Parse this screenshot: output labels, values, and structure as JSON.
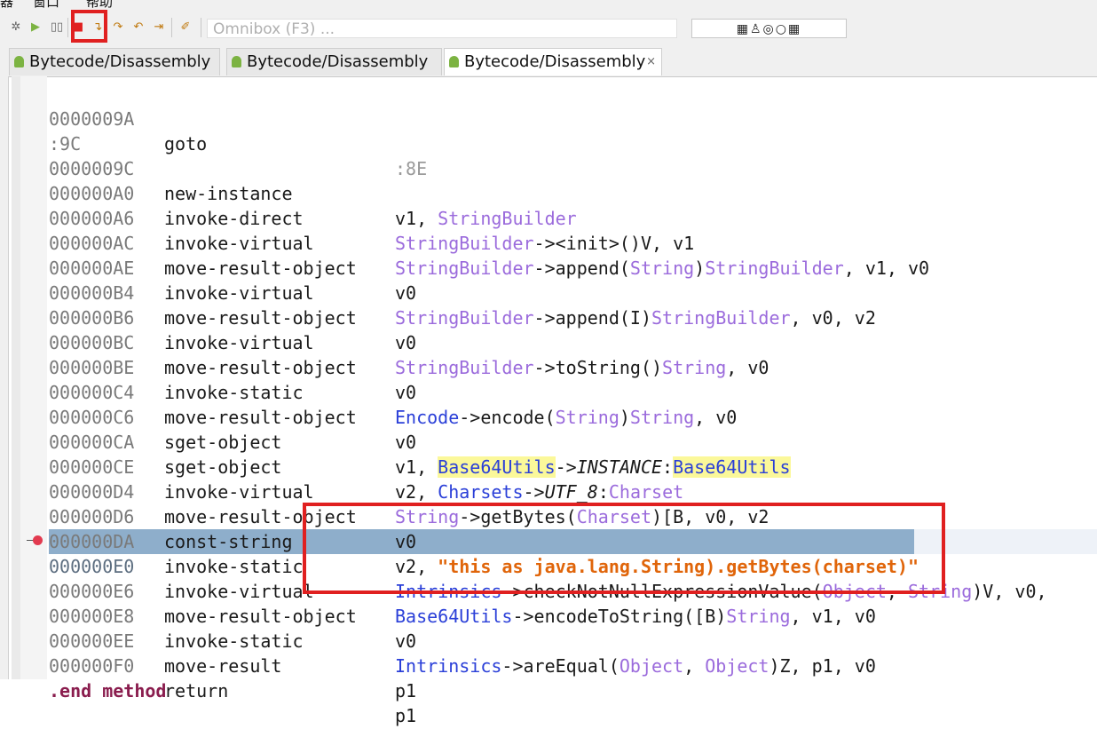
{
  "menu": {
    "item1": "器",
    "item2": "窗口",
    "item3": "帮助"
  },
  "toolbar": {
    "omnibox_placeholder": "Omnibox (F3) ...",
    "mode_icons": "▦♙◎○▦"
  },
  "tabs": [
    {
      "label": "Bytecode/Disassembly",
      "close": ""
    },
    {
      "label": "Bytecode/Disassembly",
      "close": ""
    },
    {
      "label": "Bytecode/Disassembly",
      "close": "×"
    }
  ],
  "code": {
    "l1": {
      "addr": "0000009A",
      "op": "goto",
      "a": ":8E"
    },
    "label": ":9C",
    "l2": {
      "addr": "0000009C",
      "op": "new-instance",
      "p1": "v1, ",
      "t1": "StringBuilder"
    },
    "l3": {
      "addr": "000000A0",
      "op": "invoke-direct",
      "t1": "StringBuilder",
      "p1": "-><init>()V, v1"
    },
    "l4": {
      "addr": "000000A6",
      "op": "invoke-virtual",
      "t1": "StringBuilder",
      "p1": "->append(",
      "t2": "String",
      "p2": ")",
      "t3": "StringBuilder",
      "p3": ", v1, v0"
    },
    "l5": {
      "addr": "000000AC",
      "op": "move-result-object",
      "a": "v0"
    },
    "l6": {
      "addr": "000000AE",
      "op": "invoke-virtual",
      "t1": "StringBuilder",
      "p1": "->append(I)",
      "t2": "StringBuilder",
      "p2": ", v0, v2"
    },
    "l7": {
      "addr": "000000B4",
      "op": "move-result-object",
      "a": "v0"
    },
    "l8": {
      "addr": "000000B6",
      "op": "invoke-virtual",
      "t1": "StringBuilder",
      "p1": "->toString()",
      "t2": "String",
      "p2": ", v0"
    },
    "l9": {
      "addr": "000000BC",
      "op": "move-result-object",
      "a": "v0"
    },
    "l10": {
      "addr": "000000BE",
      "op": "invoke-static",
      "c1": "Encode",
      "p1": "->encode(",
      "t1": "String",
      "p2": ")",
      "t2": "String",
      "p3": ", v0"
    },
    "l11": {
      "addr": "000000C4",
      "op": "move-result-object",
      "a": "v0"
    },
    "l12": {
      "addr": "000000C6",
      "op": "sget-object",
      "p0": "v1, ",
      "c1": "Base64Utils",
      "p1": "->",
      "i1": "INSTANCE",
      "p2": ":",
      "c2": "Base64Utils"
    },
    "l13": {
      "addr": "000000CA",
      "op": "sget-object",
      "p0": "v2, ",
      "c1": "Charsets",
      "p1": "->",
      "i1": "UTF_8",
      "p2": ":",
      "t1": "Charset"
    },
    "l14": {
      "addr": "000000CE",
      "op": "invoke-virtual",
      "t1": "String",
      "p1": "->getBytes(",
      "t2": "Charset",
      "p2": ")[B, v0, v2"
    },
    "l15": {
      "addr": "000000D4",
      "op": "move-result-object",
      "a": "v0"
    },
    "l16": {
      "addr": "000000D6",
      "op": "const-string",
      "p0": "v2, ",
      "s1": "\"this as java.lang.String).getBytes(charset)\""
    },
    "l17": {
      "addr": "000000DA",
      "op": "invoke-static",
      "c1": "Intrinsics",
      "p1": "->checkNotNullExpressionValue(",
      "t1": "Object",
      "p2": ", ",
      "t2": "String",
      "p3": ")V, v0,"
    },
    "l18": {
      "addr": "000000E0",
      "op": "invoke-virtual",
      "c1": "Base64Utils",
      "p1": "->encodeToString([B)",
      "t1": "String",
      "p2": ", v1, v0"
    },
    "l19": {
      "addr": "000000E6",
      "op": "move-result-object",
      "a": "v0"
    },
    "l20": {
      "addr": "000000E8",
      "op": "invoke-static",
      "c1": "Intrinsics",
      "p1": "->areEqual(",
      "t1": "Object",
      "p2": ", ",
      "t2": "Object",
      "p3": ")Z, p1, v0"
    },
    "l21": {
      "addr": "000000EE",
      "op": "move-result",
      "a": "p1"
    },
    "l22": {
      "addr": "000000F0",
      "op": "return",
      "a": "p1"
    },
    "end": ".end method"
  },
  "colors": {
    "highlight": "#8eaecb",
    "annotation": "#e02020",
    "type": "#9b6bdc",
    "class": "#2a3fd8",
    "string": "#e0650a"
  }
}
